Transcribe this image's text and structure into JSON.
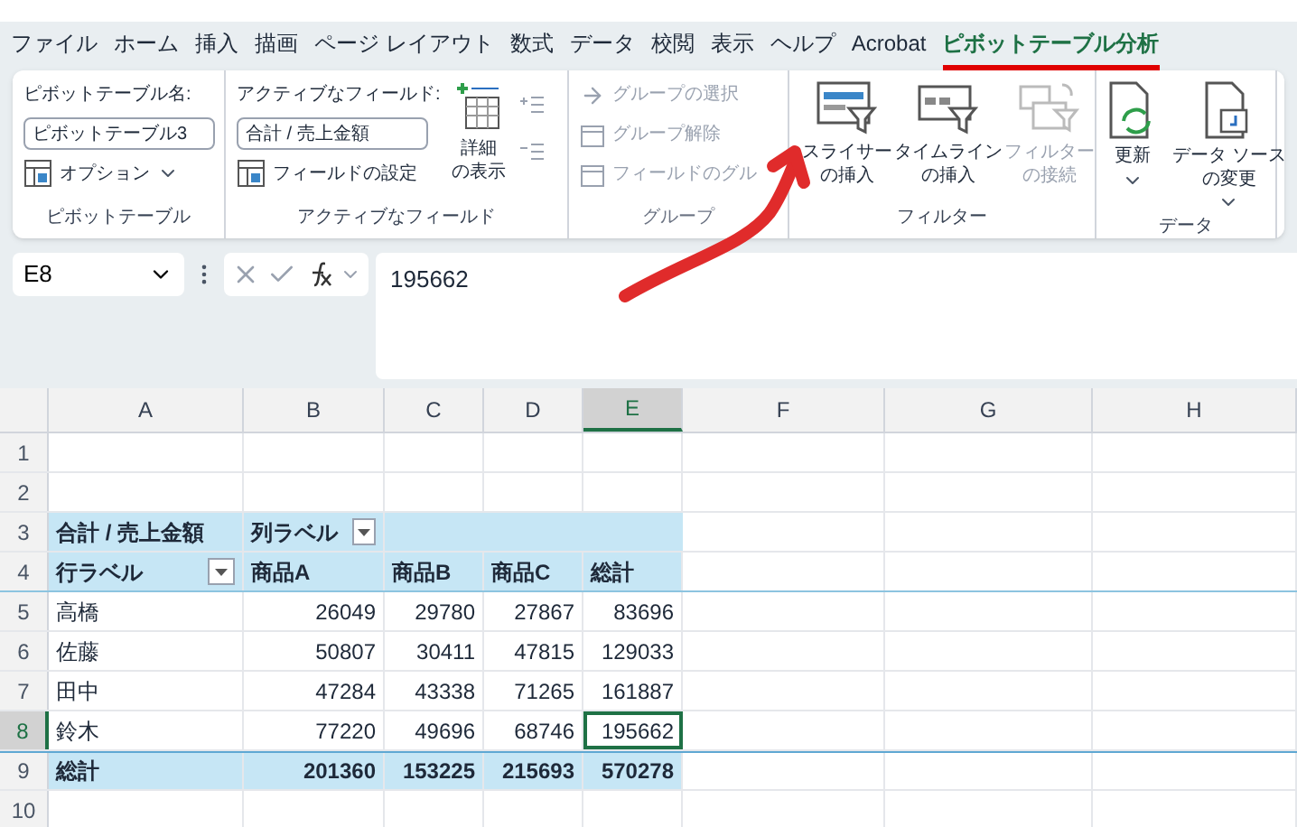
{
  "tabs": [
    {
      "label": "ファイル",
      "selected": false
    },
    {
      "label": "ホーム",
      "selected": false
    },
    {
      "label": "挿入",
      "selected": false
    },
    {
      "label": "描画",
      "selected": false
    },
    {
      "label": "ページ レイアウト",
      "selected": false
    },
    {
      "label": "数式",
      "selected": false
    },
    {
      "label": "データ",
      "selected": false
    },
    {
      "label": "校閲",
      "selected": false
    },
    {
      "label": "表示",
      "selected": false
    },
    {
      "label": "ヘルプ",
      "selected": false
    },
    {
      "label": "Acrobat",
      "selected": false
    },
    {
      "label": "ピボットテーブル分析",
      "selected": true
    }
  ],
  "ribbon": {
    "pivot_table": {
      "label": "ピボットテーブル",
      "name_label": "ピボットテーブル名:",
      "name_value": "ピボットテーブル3",
      "options_button": "オプション"
    },
    "active_field": {
      "label": "アクティブなフィールド",
      "field_label": "アクティブなフィールド:",
      "field_value": "合計 / 売上金額",
      "settings_button": "フィールドの設定",
      "details_button": [
        "詳細",
        "の表示"
      ]
    },
    "group": {
      "label": "グループ",
      "disabled": true,
      "items": [
        "グループの選択",
        "グループ解除",
        "フィールドのグル"
      ]
    },
    "filter": {
      "label": "フィルター",
      "buttons": [
        {
          "kind": "slicer",
          "lines": [
            "スライサー",
            "の挿入"
          ],
          "disabled": false
        },
        {
          "kind": "timeline",
          "lines": [
            "タイムライン",
            "の挿入"
          ],
          "disabled": false
        },
        {
          "kind": "connections",
          "lines": [
            "フィルター",
            "の接続"
          ],
          "disabled": true
        }
      ]
    },
    "data": {
      "label": "データ",
      "buttons": [
        {
          "kind": "refresh",
          "lines": [
            "更新"
          ],
          "dropdown": true
        },
        {
          "kind": "source",
          "lines": [
            "データ ソース",
            "の変更"
          ],
          "dropdown": true
        }
      ]
    }
  },
  "formula_bar": {
    "name_box": "E8",
    "formula": "195662"
  },
  "sheet": {
    "columns": [
      {
        "label": "A",
        "selected": false
      },
      {
        "label": "B",
        "selected": false
      },
      {
        "label": "C",
        "selected": false
      },
      {
        "label": "D",
        "selected": false
      },
      {
        "label": "E",
        "selected": true
      },
      {
        "label": "F",
        "selected": false
      },
      {
        "label": "G",
        "selected": false
      },
      {
        "label": "H",
        "selected": false
      }
    ],
    "rows": [
      {
        "label": "1",
        "selected": false,
        "kind": "empty"
      },
      {
        "label": "2",
        "selected": false,
        "kind": "empty"
      },
      {
        "label": "3",
        "selected": false,
        "kind": "pivot-title",
        "value_label": "合計 / 売上金額",
        "column_label": "列ラベル"
      },
      {
        "label": "4",
        "selected": false,
        "kind": "pivot-header",
        "row_label": "行ラベル",
        "values": [
          "商品A",
          "商品B",
          "商品C",
          "総計"
        ]
      },
      {
        "label": "5",
        "selected": false,
        "kind": "pivot-data",
        "name": "高橋",
        "values": [
          "26049",
          "29780",
          "27867",
          "83696"
        ]
      },
      {
        "label": "6",
        "selected": false,
        "kind": "pivot-data",
        "name": "佐藤",
        "values": [
          "50807",
          "30411",
          "47815",
          "129033"
        ]
      },
      {
        "label": "7",
        "selected": false,
        "kind": "pivot-data",
        "name": "田中",
        "values": [
          "47284",
          "43338",
          "71265",
          "161887"
        ]
      },
      {
        "label": "8",
        "selected": true,
        "kind": "pivot-data",
        "name": "鈴木",
        "values": [
          "77220",
          "49696",
          "68746",
          "195662"
        ]
      },
      {
        "label": "9",
        "selected": false,
        "kind": "pivot-total",
        "name": "総計",
        "values": [
          "201360",
          "153225",
          "215693",
          "570278"
        ]
      },
      {
        "label": "10",
        "selected": false,
        "kind": "empty"
      }
    ]
  }
}
